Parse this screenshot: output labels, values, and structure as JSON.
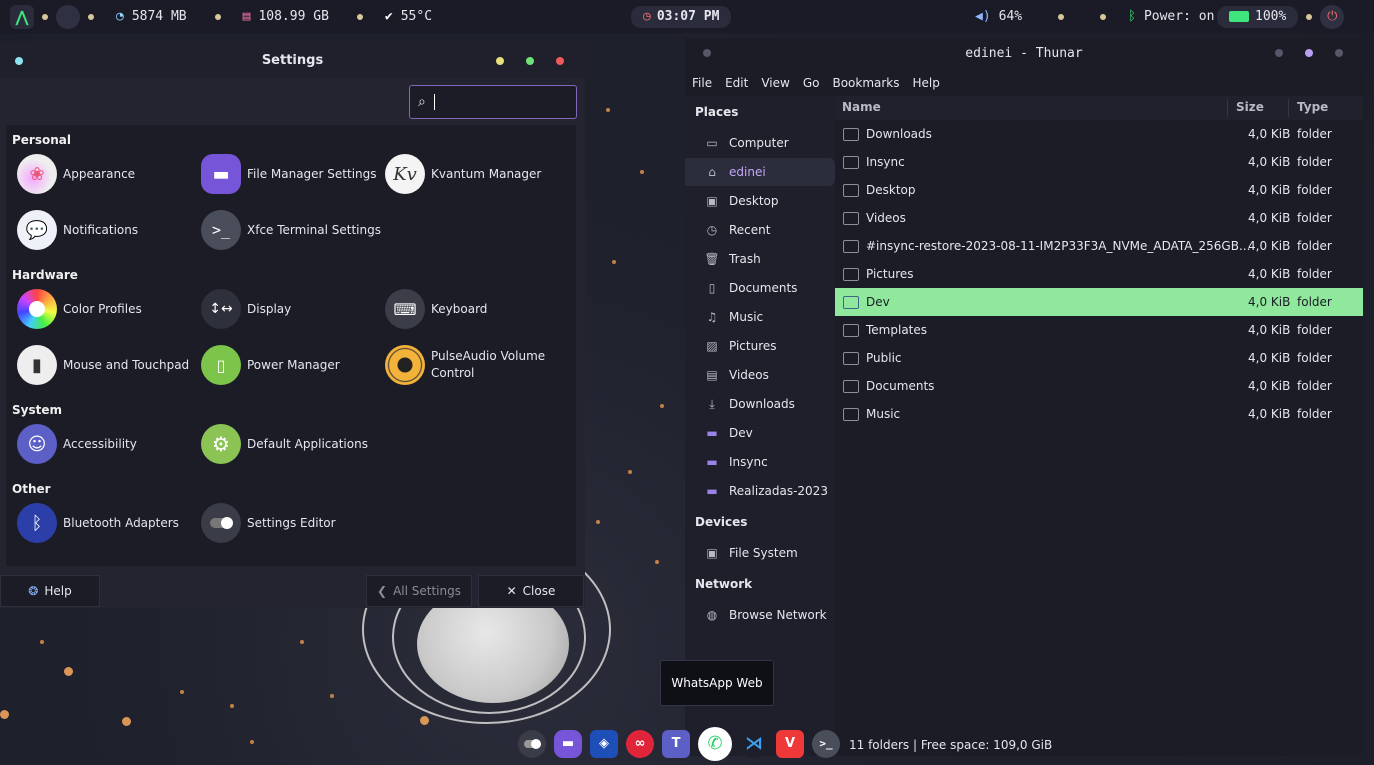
{
  "topbar": {
    "ram": "5874 MB",
    "disk": "108.99 GB",
    "temp": "55°C",
    "clock": "03:07 PM",
    "volume": "64%",
    "bluetooth": "Power: on",
    "battery": "100%"
  },
  "settings": {
    "title": "Settings",
    "search_placeholder": "",
    "categories": {
      "personal": "Personal",
      "hardware": "Hardware",
      "system": "System",
      "other": "Other"
    },
    "items": {
      "appearance": "Appearance",
      "file_manager": "File Manager Settings",
      "kvantum": "Kvantum Manager",
      "notifications": "Notifications",
      "terminal": "Xfce Terminal Settings",
      "color_profiles": "Color Profiles",
      "display": "Display",
      "keyboard": "Keyboard",
      "mouse": "Mouse and Touchpad",
      "power": "Power Manager",
      "pulseaudio": "PulseAudio Volume Control",
      "accessibility": "Accessibility",
      "default_apps": "Default Applications",
      "bluetooth": "Bluetooth Adapters",
      "settings_editor": "Settings Editor"
    },
    "buttons": {
      "help": "Help",
      "all_settings": "All Settings",
      "close": "Close"
    }
  },
  "thunar": {
    "title": "edinei - Thunar",
    "menu": [
      "File",
      "Edit",
      "View",
      "Go",
      "Bookmarks",
      "Help"
    ],
    "sections": {
      "places": "Places",
      "devices": "Devices",
      "network": "Network"
    },
    "places": [
      "Computer",
      "edinei",
      "Desktop",
      "Recent",
      "Trash",
      "Documents",
      "Music",
      "Pictures",
      "Videos",
      "Downloads",
      "Dev",
      "Insync",
      "Realizadas-2023"
    ],
    "devices": [
      "File System"
    ],
    "network": [
      "Browse Network"
    ],
    "columns": {
      "name": "Name",
      "size": "Size",
      "type": "Type"
    },
    "files": [
      {
        "name": "Downloads",
        "size": "4,0 KiB",
        "type": "folder"
      },
      {
        "name": "Insync",
        "size": "4,0 KiB",
        "type": "folder"
      },
      {
        "name": "Desktop",
        "size": "4,0 KiB",
        "type": "folder"
      },
      {
        "name": "Videos",
        "size": "4,0 KiB",
        "type": "folder"
      },
      {
        "name": "#insync-restore-2023-08-11-IM2P33F3A_NVMe_ADATA_256GB...",
        "size": "4,0 KiB",
        "type": "folder"
      },
      {
        "name": "Pictures",
        "size": "4,0 KiB",
        "type": "folder"
      },
      {
        "name": "Dev",
        "size": "4,0 KiB",
        "type": "folder"
      },
      {
        "name": "Templates",
        "size": "4,0 KiB",
        "type": "folder"
      },
      {
        "name": "Public",
        "size": "4,0 KiB",
        "type": "folder"
      },
      {
        "name": "Documents",
        "size": "4,0 KiB",
        "type": "folder"
      },
      {
        "name": "Music",
        "size": "4,0 KiB",
        "type": "folder"
      }
    ],
    "status": "11 folders  |  Free space: 109,0 GiB"
  },
  "tooltip": "WhatsApp Web",
  "colors": {
    "accent_purple": "#c5a8f5",
    "selection_green": "#8fe89b",
    "search_border": "#8467b8"
  }
}
